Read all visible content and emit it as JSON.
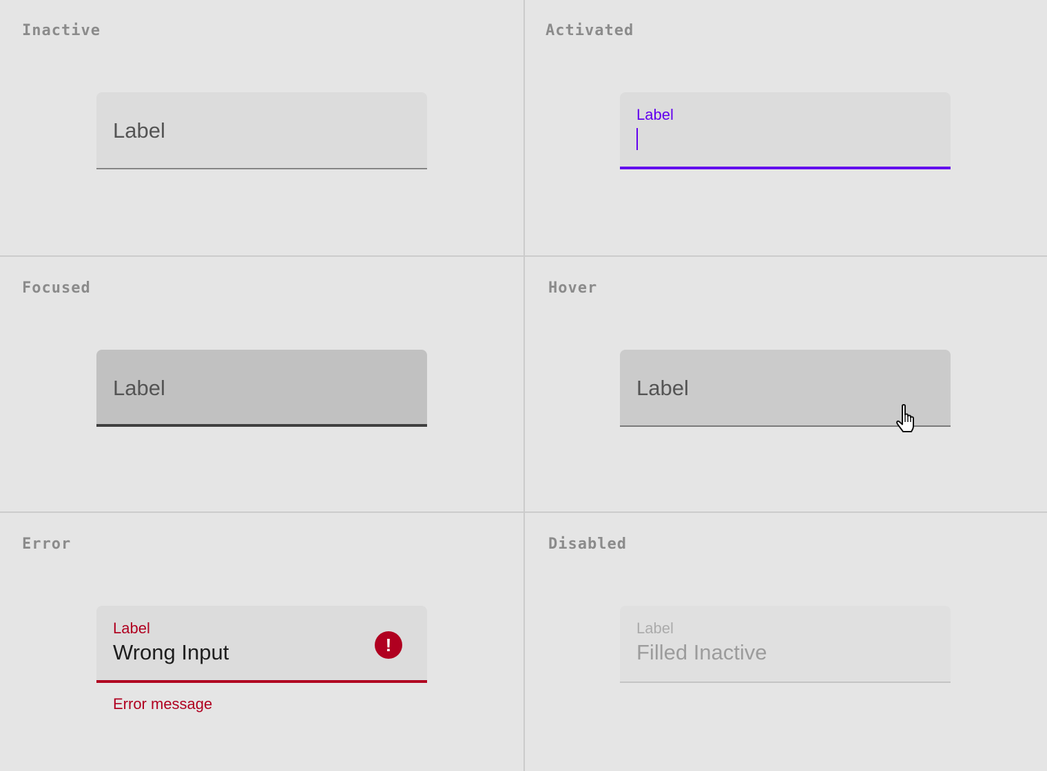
{
  "colors": {
    "background": "#e5e5e5",
    "field_fill": "#dcdcdc",
    "primary": "#6200ee",
    "error": "#b00020",
    "state_title": "#8b8b8b"
  },
  "states": {
    "inactive": {
      "title": "Inactive",
      "label": "Label"
    },
    "activated": {
      "title": "Activated",
      "label": "Label",
      "value": ""
    },
    "focused": {
      "title": "Focused",
      "label": "Label"
    },
    "hover": {
      "title": "Hover",
      "label": "Label",
      "cursor_icon": "hand-pointer-cursor-icon"
    },
    "error": {
      "title": "Error",
      "label": "Label",
      "value": "Wrong Input",
      "helper": "Error message",
      "icon": "error-alert-icon",
      "icon_glyph": "!"
    },
    "disabled": {
      "title": "Disabled",
      "label": "Label",
      "value": "Filled Inactive"
    }
  }
}
